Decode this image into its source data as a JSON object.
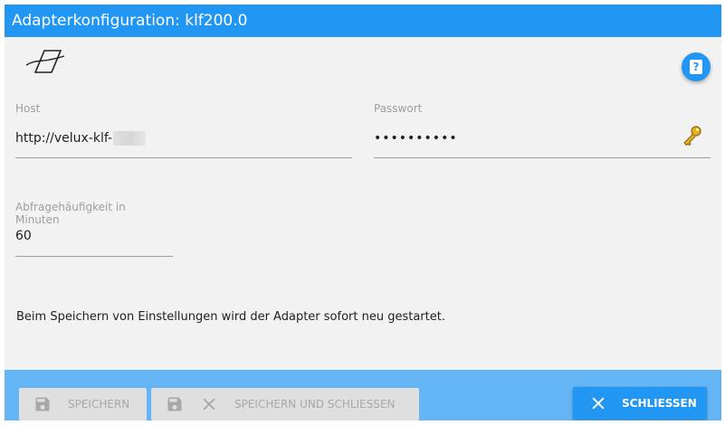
{
  "dialog": {
    "title": "Adapterkonfiguration: klf200.0"
  },
  "logo": {
    "icon": "velux-klf-logo"
  },
  "help": {
    "icon": "help-book-icon"
  },
  "fields": {
    "host": {
      "label": "Host",
      "value": "http://velux-klf-"
    },
    "password": {
      "label": "Passwort",
      "value": "••••••••••",
      "icon": "key-icon"
    },
    "polling": {
      "label_line1": "Abfragehäufigkeit in",
      "label_line2": "Minuten",
      "value": "60"
    }
  },
  "notice": "Beim Speichern von Einstellungen wird der Adapter sofort neu gestartet.",
  "footer": {
    "save_label": "SPEICHERN",
    "save_close_label": "SPEICHERN UND SCHLIESSEN",
    "close_label": "SCHLIESSEN"
  },
  "colors": {
    "accent": "#2196f3",
    "footer": "#64b5f6",
    "key": "#d4a017"
  }
}
